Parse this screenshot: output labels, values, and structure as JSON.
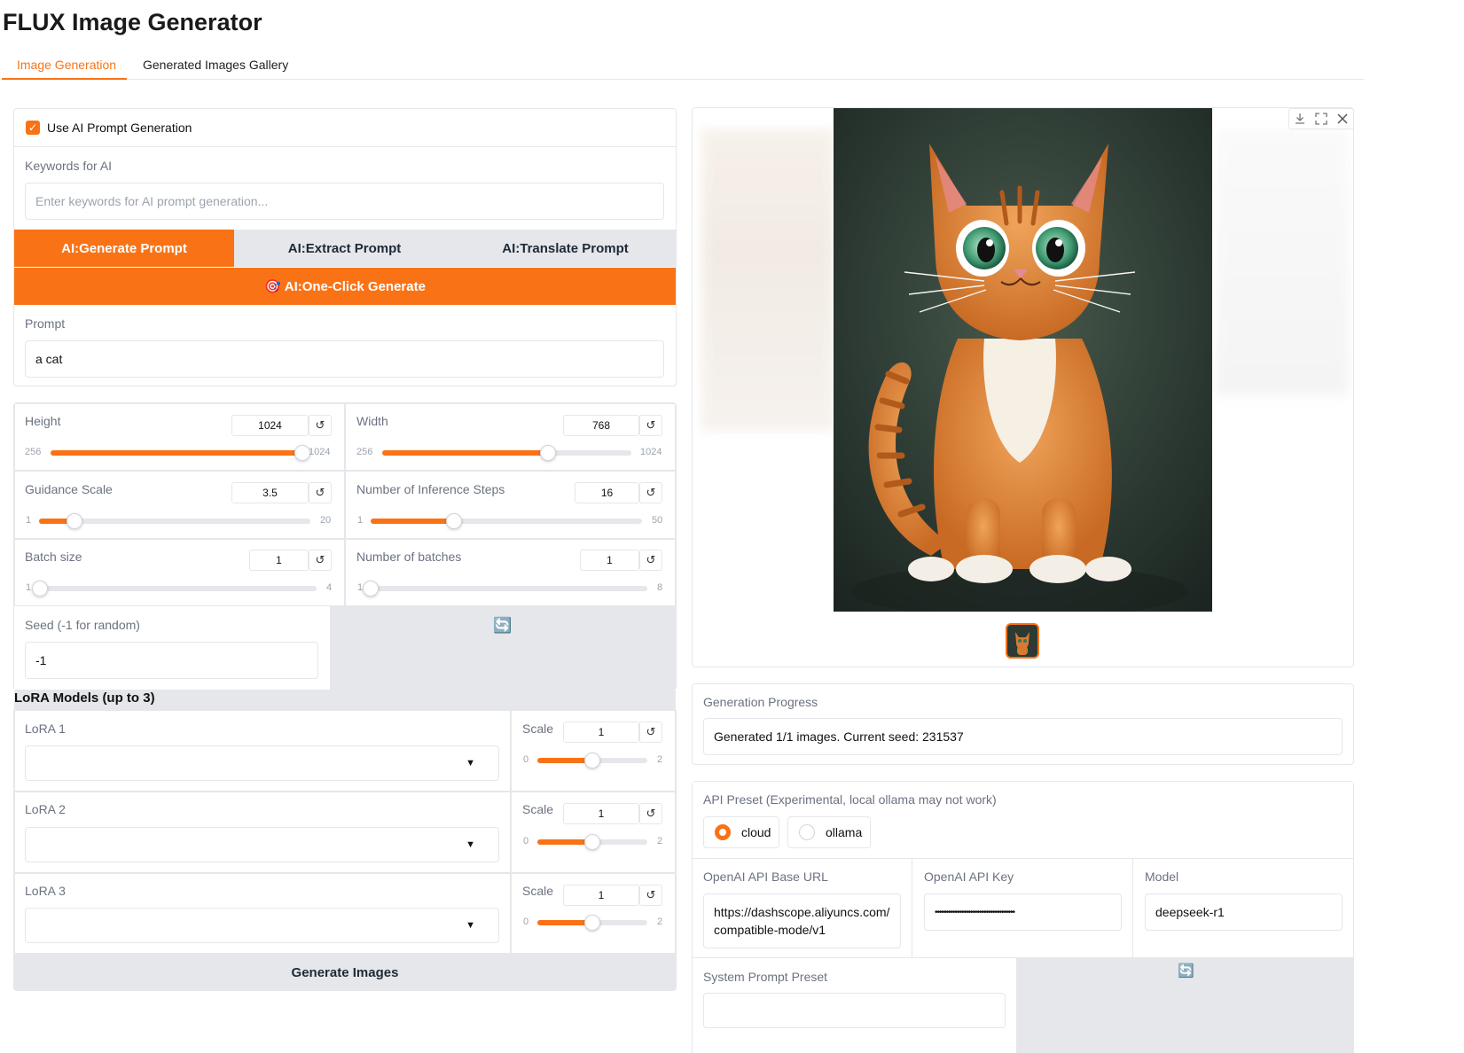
{
  "app": {
    "title": "FLUX Image Generator"
  },
  "tabs": [
    {
      "label": "Image Generation",
      "active": true
    },
    {
      "label": "Generated Images Gallery",
      "active": false
    }
  ],
  "ai": {
    "use_ai_label": "Use AI Prompt Generation",
    "use_ai_checked": true,
    "keywords_label": "Keywords for AI",
    "keywords_placeholder": "Enter keywords for AI prompt generation...",
    "generate_prompt": "AI:Generate Prompt",
    "extract_prompt": "AI:Extract Prompt",
    "translate_prompt": "AI:Translate Prompt",
    "one_click": "AI:One-Click Generate",
    "one_click_icon": "🎯"
  },
  "prompt": {
    "label": "Prompt",
    "value": "a cat"
  },
  "sliders": {
    "height": {
      "label": "Height",
      "value": "1024",
      "min": "256",
      "max": "1024",
      "fraction": 1.0
    },
    "width": {
      "label": "Width",
      "value": "768",
      "min": "256",
      "max": "1024",
      "fraction": 0.667
    },
    "guidance": {
      "label": "Guidance Scale",
      "value": "3.5",
      "min": "1",
      "max": "20",
      "fraction": 0.13
    },
    "steps": {
      "label": "Number of Inference Steps",
      "value": "16",
      "min": "1",
      "max": "50",
      "fraction": 0.306
    },
    "batch_size": {
      "label": "Batch size",
      "value": "1",
      "min": "1",
      "max": "4",
      "fraction": 0.0
    },
    "batches": {
      "label": "Number of batches",
      "value": "1",
      "min": "1",
      "max": "8",
      "fraction": 0.0
    }
  },
  "reset_glyph": "↺",
  "seed": {
    "label": "Seed (-1 for random)",
    "value": "-1",
    "refresh_icon": "🔄"
  },
  "lora": {
    "heading": "LoRA Models (up to 3)",
    "items": [
      {
        "label": "LoRA 1",
        "scale_label": "Scale",
        "scale": "1",
        "min": "0",
        "max": "2",
        "fraction": 0.5
      },
      {
        "label": "LoRA 2",
        "scale_label": "Scale",
        "scale": "1",
        "min": "0",
        "max": "2",
        "fraction": 0.5
      },
      {
        "label": "LoRA 3",
        "scale_label": "Scale",
        "scale": "1",
        "min": "0",
        "max": "2",
        "fraction": 0.5
      }
    ]
  },
  "generate_button": "Generate Images",
  "progress": {
    "label": "Generation Progress",
    "value": "Generated 1/1 images. Current seed: 231537"
  },
  "api": {
    "preset_label": "API Preset (Experimental, local ollama may not work)",
    "options": [
      {
        "label": "cloud",
        "selected": true
      },
      {
        "label": "ollama",
        "selected": false
      }
    ],
    "base_url_label": "OpenAI API Base URL",
    "base_url_line1": "https://dashscope.aliyuncs.com/",
    "base_url_line2": "compatible-mode/v1",
    "key_label": "OpenAI API Key",
    "key_value": "••••••••••••••••••••••••••••••••••••",
    "model_label": "Model",
    "model_value": "deepseek-r1",
    "system_prompt_label": "System Prompt Preset",
    "refresh_icon": "🔄"
  },
  "colors": {
    "accent": "#f97316",
    "gray_button": "#e5e7eb",
    "border": "#e5e7eb"
  }
}
